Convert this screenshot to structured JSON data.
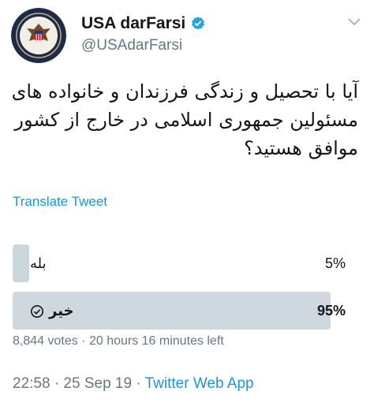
{
  "account": {
    "name": "USA darFarsi",
    "handle": "@USAdarFarsi",
    "verified": true,
    "avatar_icon": "department-of-state-seal-icon"
  },
  "tweet": {
    "text": "آیا با تحصیل و زندگی فرزندان و خانواده های مسئولین جمهوری اسلامی در خارج از کشور موافق هستید؟"
  },
  "translate_label": "Translate Tweet",
  "poll": {
    "options": [
      {
        "label": "بله",
        "percent_text": "5%",
        "percent": 5,
        "winner": false
      },
      {
        "label": "خیر",
        "percent_text": "95%",
        "percent": 95,
        "winner": true
      }
    ],
    "meta": "8,844 votes · 20 hours 16 minutes left"
  },
  "timestamp": {
    "datetime": "22:58 · 25 Sep 19 · ",
    "source": "Twitter Web App"
  },
  "colors": {
    "accent": "#1b95e0",
    "muted": "#657786",
    "poll_bar": "#ccd6dd"
  }
}
